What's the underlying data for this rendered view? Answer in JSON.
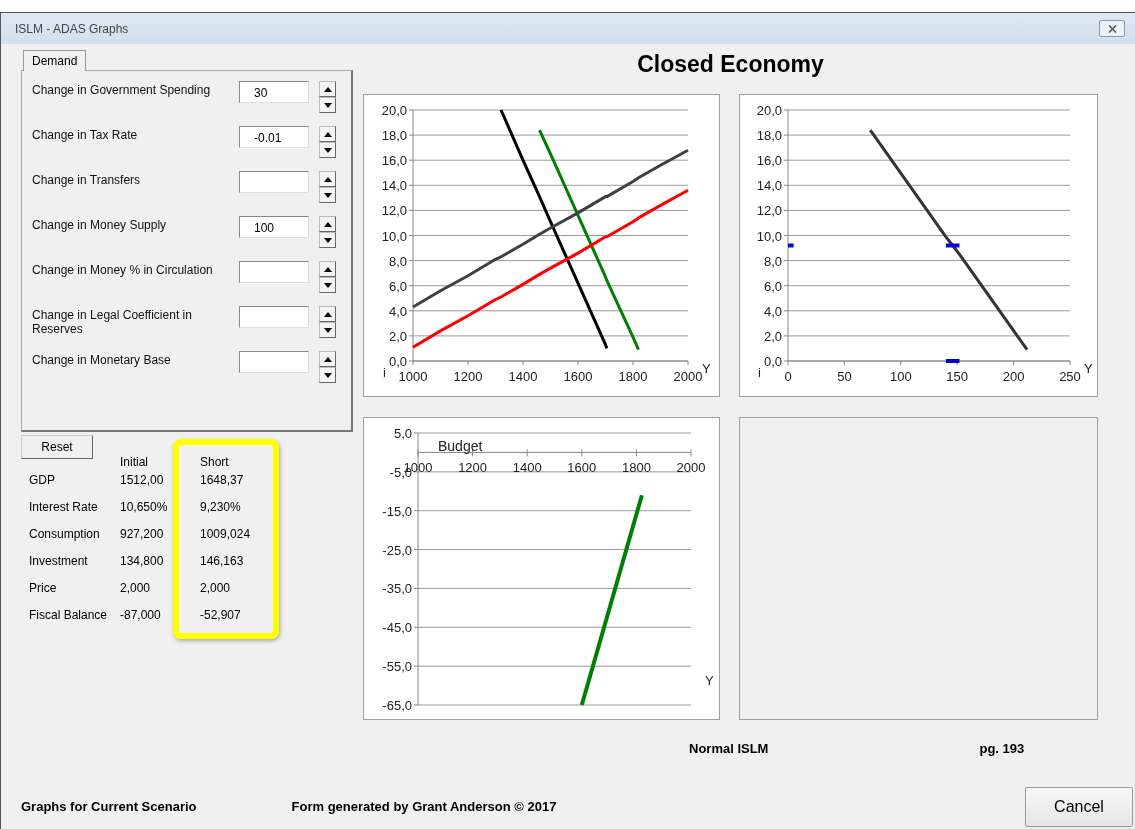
{
  "window": {
    "title": "ISLM - ADAS Graphs"
  },
  "tabs": [
    {
      "label": "Demand",
      "selected": true
    }
  ],
  "parameters": [
    {
      "label": "Change in Government Spending",
      "value": "30"
    },
    {
      "label": "Change in Tax Rate",
      "value": "-0.01"
    },
    {
      "label": "Change in Transfers"
    },
    {
      "label": "Change in Money Supply",
      "value": "100"
    },
    {
      "label": "Change in Money % in Circulation"
    },
    {
      "label": "Change in Legal Coefficient in Reserves"
    },
    {
      "label": "Change in Monetary Base"
    }
  ],
  "reset_button": "Reset",
  "results": {
    "columns": [
      {
        "label": "Initial",
        "highlighted": false
      },
      {
        "label": "Short",
        "highlighted": true
      }
    ],
    "rows": [
      {
        "label": "GDP",
        "cells": [
          "1512,00",
          "1648,37"
        ]
      },
      {
        "label": "Interest Rate",
        "cells": [
          "10,650%",
          "9,230%"
        ]
      },
      {
        "label": "Consumption",
        "cells": [
          "927,200",
          "1009,024"
        ]
      },
      {
        "label": "Investment",
        "cells": [
          "134,800",
          "146,163"
        ]
      },
      {
        "label": "Price",
        "cells": [
          "2,000",
          "2,000"
        ]
      },
      {
        "label": "Fiscal Balance",
        "cells": [
          "-87,000",
          "-52,907"
        ]
      }
    ]
  },
  "title": "Closed Economy",
  "panels": [
    {
      "kind": "chart",
      "chart_data": {
        "type": "line",
        "xlabel": "Y",
        "ylabel": "i",
        "x": [
          1000,
          1100,
          1200,
          1300,
          1320,
          1400,
          1460,
          1500,
          1600,
          1700,
          1705,
          1800,
          1820,
          1900,
          2000
        ],
        "series": [
          {
            "color": "#000000",
            "values": [
              null,
              null,
              null,
              null,
              20.0,
              16.0,
              13.1,
              11.1,
              6.2,
              1.3,
              1.0,
              null,
              null,
              null,
              null
            ]
          },
          {
            "color": "#008000",
            "values": [
              null,
              null,
              null,
              null,
              null,
              null,
              18.4,
              16.5,
              11.6,
              6.7,
              6.4,
              1.9,
              0.9,
              null,
              null
            ]
          },
          {
            "color": "#404040",
            "values": [
              4.3,
              5.6,
              6.8,
              8.1,
              8.3,
              9.3,
              10.1,
              10.6,
              11.8,
              13.1,
              13.1,
              14.3,
              14.6,
              15.6,
              16.8
            ]
          },
          {
            "color": "#ff0000",
            "values": [
              1.1,
              2.4,
              3.6,
              4.9,
              5.1,
              6.1,
              6.9,
              7.4,
              8.6,
              9.9,
              9.9,
              11.1,
              11.4,
              12.4,
              13.6
            ]
          }
        ],
        "grid": true,
        "xlim": [
          1000,
          2000
        ],
        "ylim": [
          0,
          20
        ],
        "xticks": [
          1000,
          1200,
          1400,
          1600,
          1800,
          2000
        ],
        "yticks": [
          {
            "value": 0,
            "label": "0,0"
          },
          {
            "value": 2,
            "label": "2,0"
          },
          {
            "value": 4,
            "label": "4,0"
          },
          {
            "value": 6,
            "label": "6,0"
          },
          {
            "value": 8,
            "label": "8,0"
          },
          {
            "value": 10,
            "label": "10,0"
          },
          {
            "value": 12,
            "label": "12,0"
          },
          {
            "value": 14,
            "label": "14,0"
          },
          {
            "value": 16,
            "label": "16,0"
          },
          {
            "value": 18,
            "label": "18,0"
          },
          {
            "value": 20,
            "label": "20,0"
          }
        ]
      }
    },
    {
      "kind": "chart",
      "chart_data": {
        "type": "line",
        "xlabel": "Y",
        "ylabel": "i",
        "x": [
          0,
          5,
          73,
          140,
          146,
          152,
          212
        ],
        "series": [
          {
            "color": "#333333",
            "values": [
              null,
              null,
              18.4,
              9.9,
              9.2,
              8.5,
              0.9
            ]
          },
          {
            "color": "#0000ff",
            "values": [
              9.2,
              9.2,
              null,
              null,
              null,
              null,
              null
            ]
          },
          {
            "color": "#0000e6",
            "values": [
              null,
              null,
              null,
              9.2,
              9.2,
              9.2,
              null
            ]
          },
          {
            "color": "#0000cc",
            "values": [
              null,
              null,
              null,
              0,
              0,
              0,
              null
            ]
          }
        ],
        "grid": true,
        "xlim": [
          0,
          250
        ],
        "ylim": [
          0,
          20
        ],
        "xticks": [
          0,
          50,
          100,
          150,
          200,
          250
        ],
        "yticks": [
          {
            "value": 0,
            "label": "0,0"
          },
          {
            "value": 2,
            "label": "2,0"
          },
          {
            "value": 4,
            "label": "4,0"
          },
          {
            "value": 6,
            "label": "6,0"
          },
          {
            "value": 8,
            "label": "8,0"
          },
          {
            "value": 10,
            "label": "10,0"
          },
          {
            "value": 12,
            "label": "12,0"
          },
          {
            "value": 14,
            "label": "14,0"
          },
          {
            "value": 16,
            "label": "16,0"
          },
          {
            "value": 18,
            "label": "18,0"
          },
          {
            "value": 20,
            "label": "20,0"
          }
        ]
      }
    },
    {
      "kind": "chart",
      "chart_data": {
        "type": "line",
        "title": "Budget",
        "xlabel": "Y",
        "x": [
          1600,
          1700,
          1820
        ],
        "series": [
          {
            "color": "#008000",
            "values": [
              -65,
              -40.5,
              -11
            ]
          }
        ],
        "grid": true,
        "xlim": [
          1000,
          2000
        ],
        "ylim": [
          -65,
          5
        ],
        "xticks": [
          1000,
          1200,
          1400,
          1600,
          1800,
          2000
        ],
        "yticks": [
          {
            "value": 5,
            "label": "5,0"
          },
          {
            "value": -5,
            "label": "-5,0"
          },
          {
            "value": -15,
            "label": "-15,0"
          },
          {
            "value": -25,
            "label": "-25,0"
          },
          {
            "value": -35,
            "label": "-35,0"
          },
          {
            "value": -45,
            "label": "-45,0"
          },
          {
            "value": -55,
            "label": "-55,0"
          },
          {
            "value": -65,
            "label": "-65,0"
          }
        ]
      }
    },
    {
      "kind": "empty"
    }
  ],
  "model_label": "Normal ISLM",
  "page_label": "pg. 193",
  "footer": {
    "scenario": "Graphs for Current Scenario",
    "credit": "Form generated by Grant Anderson © 2017"
  },
  "buttons": [
    "Cancel"
  ]
}
